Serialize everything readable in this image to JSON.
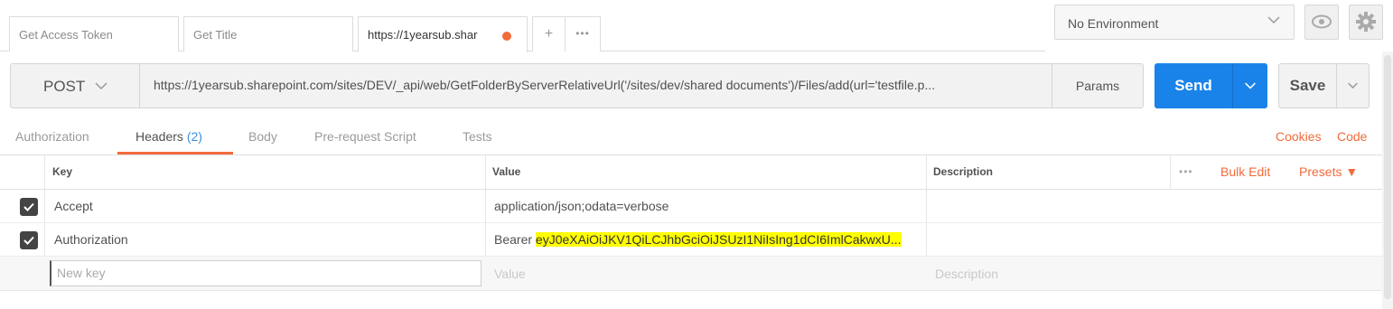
{
  "tabs": [
    {
      "label": "Get Access Token"
    },
    {
      "label": "Get Title"
    },
    {
      "label": "https://1yearsub.shar"
    }
  ],
  "tab_tools": {
    "add": "+",
    "more": "•••"
  },
  "environment": {
    "selected": "No Environment"
  },
  "request": {
    "method": "POST",
    "url": "https://1yearsub.sharepoint.com/sites/DEV/_api/web/GetFolderByServerRelativeUrl('/sites/dev/shared documents')/Files/add(url='testfile.p...",
    "params_label": "Params",
    "send_label": "Send",
    "save_label": "Save"
  },
  "subtabs": {
    "authorization": "Authorization",
    "headers": "Headers",
    "headers_count": "(2)",
    "body": "Body",
    "prerequest": "Pre-request Script",
    "tests": "Tests",
    "cookies": "Cookies",
    "code": "Code"
  },
  "table": {
    "col_key": "Key",
    "col_value": "Value",
    "col_description": "Description",
    "more": "•••",
    "bulk_edit": "Bulk Edit",
    "presets": "Presets ▼",
    "rows": [
      {
        "key": "Accept",
        "value": "application/json;odata=verbose",
        "value_highlight": ""
      },
      {
        "key": "Authorization",
        "value": "Bearer ",
        "value_highlight": "eyJ0eXAiOiJKV1QiLCJhbGciOiJSUzI1NiIsIng1dCI6ImlCakwxU..."
      }
    ],
    "new_key_placeholder": "New key",
    "new_value_placeholder": "Value",
    "new_description_placeholder": "Description"
  },
  "colors": {
    "accent": "#f26b3a",
    "send": "#1a83e9",
    "highlight": "#ffff00"
  }
}
